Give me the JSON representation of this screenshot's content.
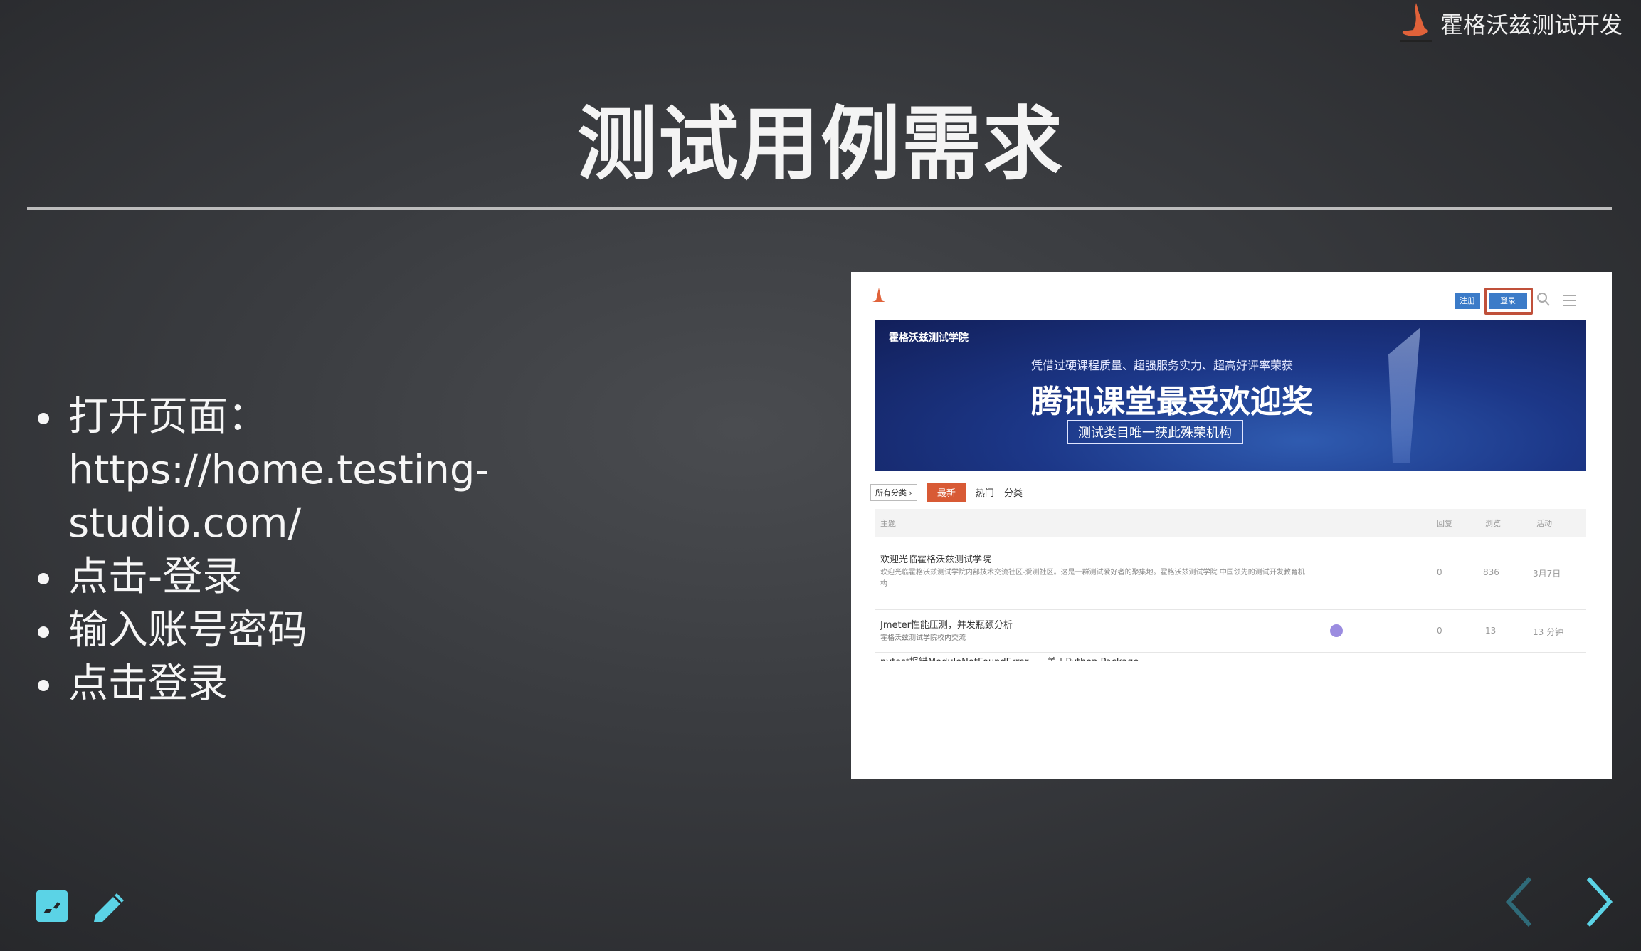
{
  "brand": {
    "name": "霍格沃兹测试开发",
    "logo_caption": "霍格沃兹测试学院",
    "logo_color": "#e0623a"
  },
  "slide": {
    "title": "测试用例需求",
    "bullets": [
      "打开页面：https://home.testing-studio.com/",
      "点击-登录",
      "输入账号密码",
      "点击登录"
    ]
  },
  "screenshot": {
    "header": {
      "register": "注册",
      "login": "登录"
    },
    "banner": {
      "logo_text": "霍格沃兹测试学院",
      "subtitle": "凭借过硬课程质量、超强服务实力、超高好评率荣获",
      "headline": "腾讯课堂最受欢迎奖",
      "tagline": "测试类目唯一获此殊荣机构"
    },
    "tabs": {
      "category": "所有分类 ›",
      "latest": "最新",
      "hot": "热门",
      "categories": "分类"
    },
    "table": {
      "columns": [
        "主题",
        "回复",
        "浏览",
        "活动"
      ],
      "rows": [
        {
          "title": "欢迎光临霍格沃兹测试学院",
          "excerpt": "欢迎光临霍格沃兹测试学院内部技术交流社区-爱测社区。这是一群测试爱好者的聚集地。霍格沃兹测试学院 中国领先的测试开发教育机构",
          "replies": "0",
          "views": "836",
          "activity": "3月7日"
        },
        {
          "title": "Jmeter性能压测，并发瓶颈分析",
          "excerpt": "霍格沃兹测试学院校内交流",
          "replies": "0",
          "views": "13",
          "activity": "13 分钟"
        },
        {
          "title": "pytest报错ModuleNotFoundError——关于Python Package",
          "excerpt": "",
          "replies": "",
          "views": "",
          "activity": ""
        }
      ]
    }
  },
  "accent": "#5bd3e6"
}
